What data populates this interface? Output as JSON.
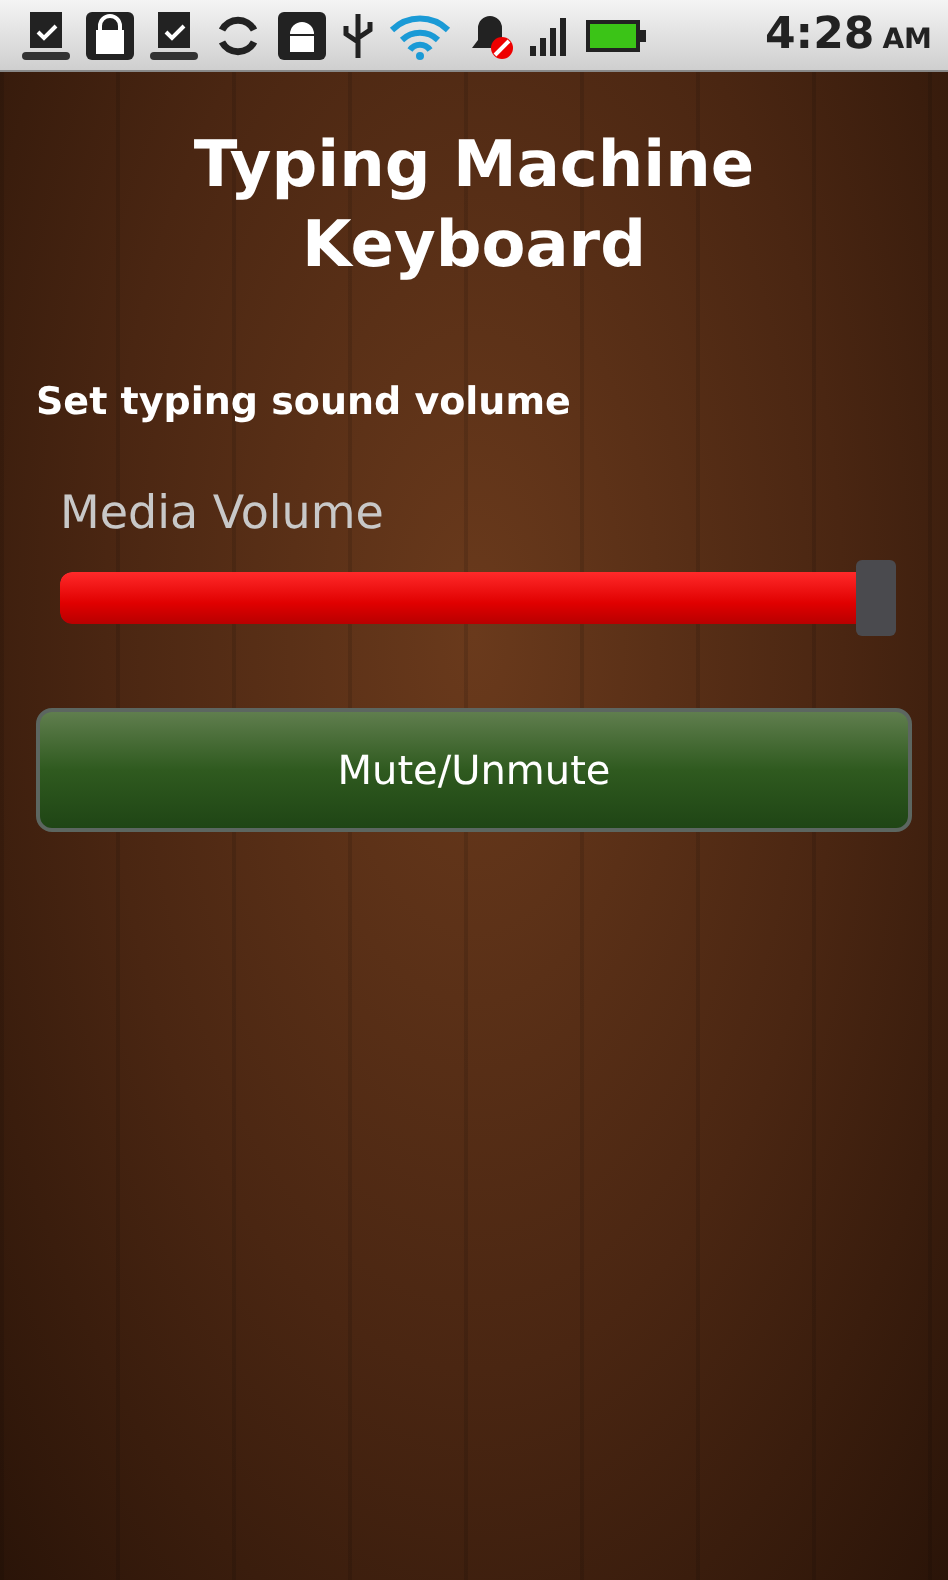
{
  "status_bar": {
    "time": "4:28",
    "am_pm": "AM"
  },
  "title": "Typing Machine Keyboard",
  "section_label": "Set typing sound volume",
  "slider": {
    "label": "Media Volume",
    "level": 1.0
  },
  "button": {
    "label": "Mute/Unmute"
  }
}
